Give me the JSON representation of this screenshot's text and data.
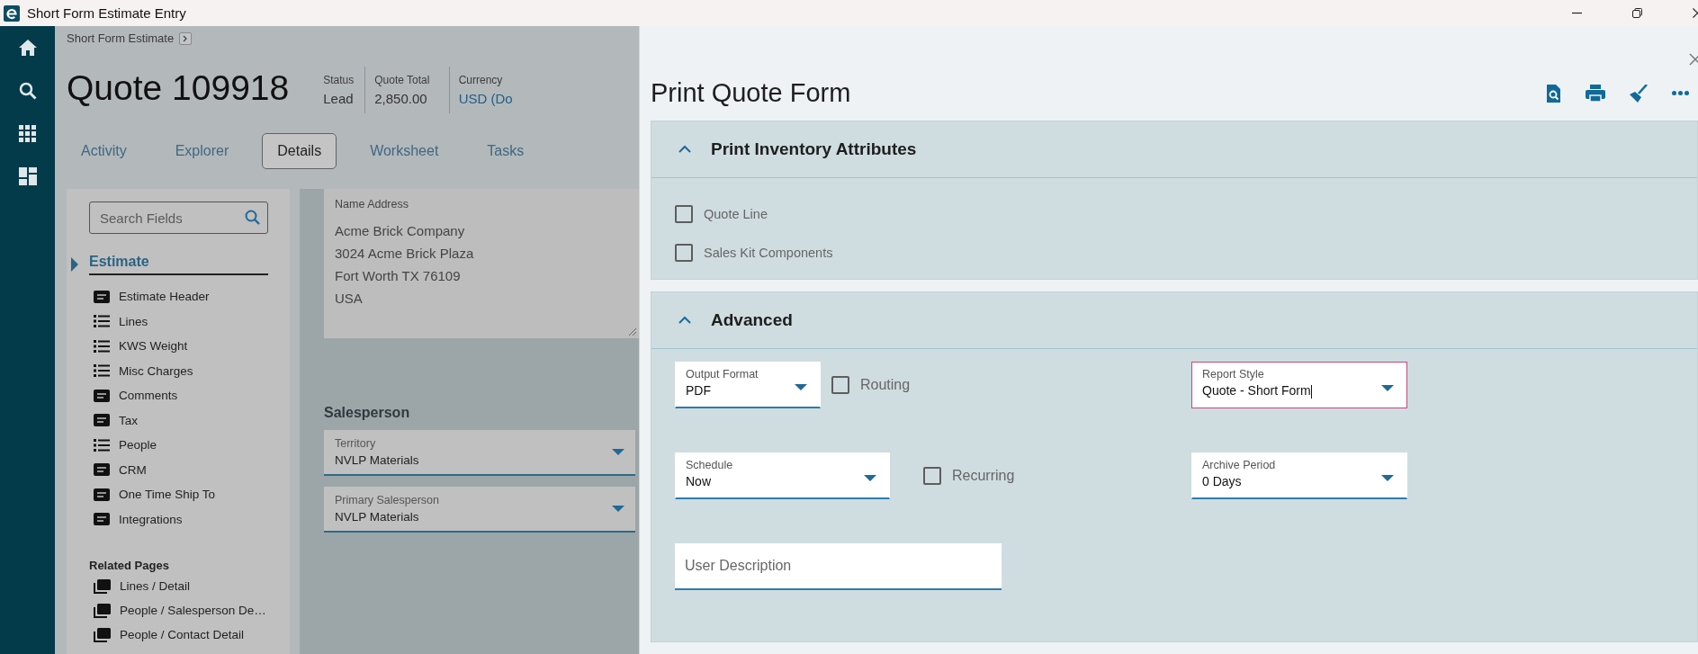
{
  "window": {
    "title": "Short Form Estimate Entry"
  },
  "breadcrumb": {
    "label": "Short Form Estimate"
  },
  "header": {
    "title": "Quote 109918",
    "fields": [
      {
        "label": "Status",
        "value": "Lead",
        "kind": "plain"
      },
      {
        "label": "Quote Total",
        "value": "2,850.00",
        "kind": "number"
      },
      {
        "label": "Currency",
        "value": "USD (Do",
        "kind": "link"
      }
    ]
  },
  "tabs": [
    {
      "label": "Activity",
      "selected": false
    },
    {
      "label": "Explorer",
      "selected": false
    },
    {
      "label": "Details",
      "selected": true
    },
    {
      "label": "Worksheet",
      "selected": false
    },
    {
      "label": "Tasks",
      "selected": false
    }
  ],
  "sidebar": {
    "search": {
      "placeholder": "Search Fields"
    },
    "section": "Estimate",
    "items": [
      {
        "label": "Estimate Header",
        "kind": "card"
      },
      {
        "label": "Lines",
        "kind": "list"
      },
      {
        "label": "KWS Weight",
        "kind": "list"
      },
      {
        "label": "Misc Charges",
        "kind": "list"
      },
      {
        "label": "Comments",
        "kind": "card"
      },
      {
        "label": "Tax",
        "kind": "card"
      },
      {
        "label": "People",
        "kind": "list"
      },
      {
        "label": "CRM",
        "kind": "card"
      },
      {
        "label": "One Time Ship To",
        "kind": "card"
      },
      {
        "label": "Integrations",
        "kind": "card"
      }
    ],
    "related_title": "Related Pages",
    "related_pages": [
      "Lines / Detail",
      "People / Salesperson De…",
      "People / Contact Detail"
    ]
  },
  "name_address": {
    "label": "Name Address",
    "lines": [
      "Acme Brick Company",
      "3024 Acme Brick Plaza",
      "Fort Worth TX 76109",
      "USA"
    ]
  },
  "salesperson": {
    "title": "Salesperson",
    "fields": [
      {
        "label": "Territory",
        "value": "NVLP Materials"
      },
      {
        "label": "Primary Salesperson",
        "value": "NVLP Materials"
      }
    ]
  },
  "dialog": {
    "title": "Print Quote Form",
    "sections": [
      {
        "title": "Print Inventory Attributes",
        "expanded": true,
        "checkboxes": [
          {
            "label": "Quote Line",
            "checked": false
          },
          {
            "label": "Sales Kit Components",
            "checked": false
          }
        ]
      },
      {
        "title": "Advanced",
        "expanded": true,
        "rows": [
          [
            {
              "kind": "dropdown",
              "label": "Output Format",
              "value": "PDF",
              "focused": false
            },
            {
              "kind": "checkbox",
              "label": "Routing",
              "checked": false
            },
            {
              "kind": "dropdown",
              "label": "Report Style",
              "value": "Quote - Short Form",
              "focused": true
            }
          ],
          [
            {
              "kind": "dropdown",
              "label": "Schedule",
              "value": "Now",
              "focused": false
            },
            {
              "kind": "checkbox",
              "label": "Recurring",
              "checked": false
            },
            {
              "kind": "dropdown",
              "label": "Archive Period",
              "value": "0 Days",
              "focused": false
            }
          ],
          [
            {
              "kind": "text",
              "placeholder": "User Description"
            }
          ]
        ]
      }
    ]
  }
}
